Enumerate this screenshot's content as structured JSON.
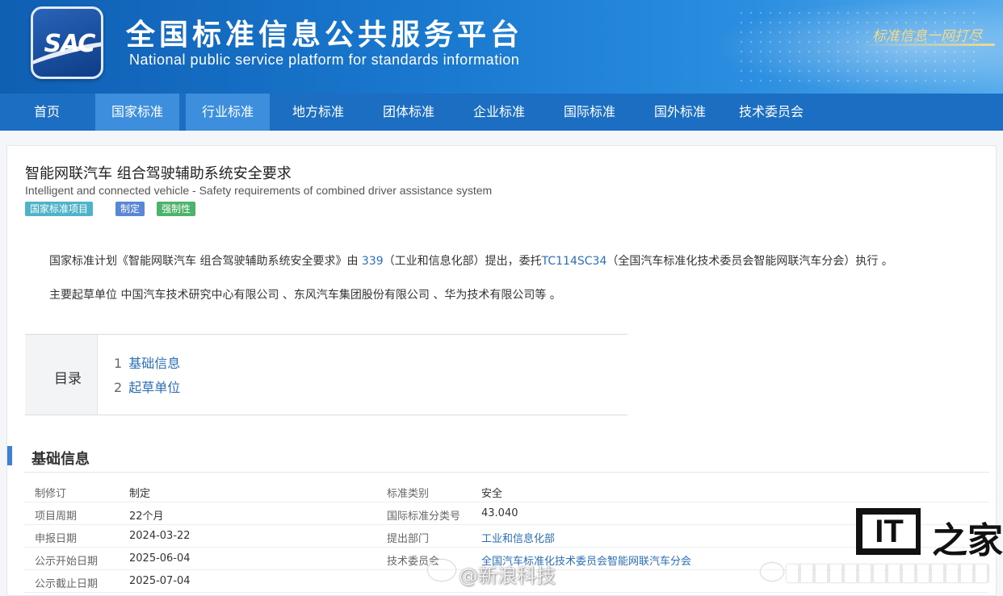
{
  "header": {
    "logo_text": "SAC",
    "title_cn": "全国标准信息公共服务平台",
    "title_en": "National public service platform  for standards information",
    "slogan": "标准信息一网打尽"
  },
  "nav": {
    "items": [
      {
        "label": "首页",
        "active": false
      },
      {
        "label": "国家标准",
        "active": true
      },
      {
        "label": "行业标准",
        "active": true
      },
      {
        "label": "地方标准",
        "active": false
      },
      {
        "label": "团体标准",
        "active": false
      },
      {
        "label": "企业标准",
        "active": false
      },
      {
        "label": "国际标准",
        "active": false
      },
      {
        "label": "国外标准",
        "active": false
      },
      {
        "label": "技术委员会",
        "active": false
      }
    ]
  },
  "standard": {
    "title_cn": "智能网联汽车 组合驾驶辅助系统安全要求",
    "title_en": "Intelligent and connected vehicle - Safety requirements of combined driver assistance system",
    "tags": [
      "国家标准项目",
      "制定",
      "强制性"
    ],
    "desc1_a": "国家标准计划《智能网联汽车 组合驾驶辅助系统安全要求》由 ",
    "desc1_link1": "339",
    "desc1_b": "（工业和信息化部）提出，委托",
    "desc1_link2": "TC114SC34",
    "desc1_c": "（全国汽车标准化技术委员会智能网联汽车分会）执行 。",
    "desc2": "主要起草单位 中国汽车技术研究中心有限公司 、东风汽车集团股份有限公司 、华为技术有限公司等 。"
  },
  "toc": {
    "label": "目录",
    "items": [
      {
        "num": "1",
        "label": "基础信息"
      },
      {
        "num": "2",
        "label": "起草单位"
      }
    ]
  },
  "basic_info": {
    "title": "基础信息",
    "rows": [
      {
        "l1": "制修订",
        "v1": "制定",
        "l2": "标准类别",
        "v2": "安全"
      },
      {
        "l1": "项目周期",
        "v1": "22个月",
        "l2": "国际标准分类号",
        "v2": "43.040"
      },
      {
        "l1": "申报日期",
        "v1": "2024-03-22",
        "l2": "提出部门",
        "v2": "工业和信息化部"
      },
      {
        "l1": "公示开始日期",
        "v1": "2025-06-04",
        "l2": "技术委员会",
        "v2": "全国汽车标准化技术委员会智能网联汽车分会"
      },
      {
        "l1": "公示截止日期",
        "v1": "2025-07-04",
        "l2": "",
        "v2": ""
      }
    ]
  },
  "watermarks": {
    "it_logo": "IT",
    "home_char": "之家",
    "weibo_text": "@新浪科技"
  }
}
